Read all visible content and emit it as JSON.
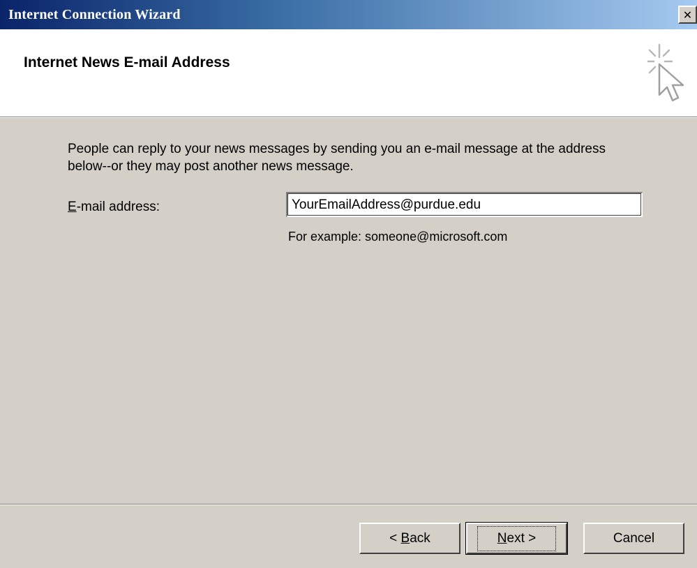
{
  "window": {
    "title": "Internet Connection Wizard",
    "close_glyph": "✕"
  },
  "header": {
    "heading": "Internet News E-mail Address",
    "icon": "wizard-sparkle-cursor-icon"
  },
  "body": {
    "description": "People can reply to your news messages by sending you an e-mail message at the address below--or they may post another news message.",
    "email": {
      "label_mnemonic": "E",
      "label_rest": "-mail address:",
      "value": "YourEmailAddress@purdue.edu",
      "example": "For example: someone@microsoft.com"
    }
  },
  "buttons": {
    "back_prefix": "< ",
    "back_mnemonic": "B",
    "back_rest": "ack",
    "next_mnemonic": "N",
    "next_rest": "ext >",
    "cancel": "Cancel"
  },
  "colors": {
    "titlebar_start": "#0a246a",
    "titlebar_end": "#a6caf0",
    "face": "#d4d0c8"
  }
}
